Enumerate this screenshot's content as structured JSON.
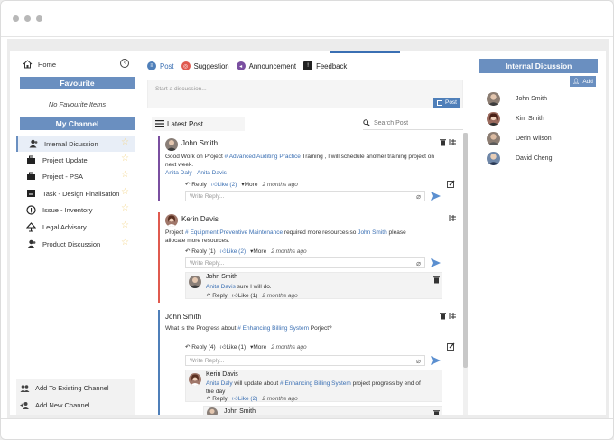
{
  "sidebar": {
    "home_label": "Home",
    "favourite_header": "Favourite",
    "no_favourite": "No Favourite Items",
    "channel_header": "My Channel",
    "channels": [
      {
        "label": "Internal Dicussion",
        "icon": "group-icon",
        "active": true
      },
      {
        "label": "Project Update",
        "icon": "briefcase-icon",
        "active": false
      },
      {
        "label": "Project - PSA",
        "icon": "briefcase-icon",
        "active": false
      },
      {
        "label": "Task - Design Finalisation",
        "icon": "task-list-icon",
        "active": false
      },
      {
        "label": "Issue - Inventory",
        "icon": "alert-circle-icon",
        "active": false
      },
      {
        "label": "Legal Advisory",
        "icon": "scale-icon",
        "active": false
      },
      {
        "label": "Product Discussion",
        "icon": "group-icon",
        "active": false
      }
    ],
    "bottom": {
      "add_existing": "Add To Existing Channel",
      "add_new": "Add New Channel"
    }
  },
  "center": {
    "tabs": [
      {
        "label": "Post",
        "icon": "post-icon",
        "color": "#4f7fb9"
      },
      {
        "label": "Suggestion",
        "icon": "lifebuoy-icon",
        "color": "#e05a4f"
      },
      {
        "label": "Announcement",
        "icon": "megaphone-icon",
        "color": "#7a4fa0"
      },
      {
        "label": "Feedback",
        "icon": "feedback-icon",
        "color": "#222222"
      }
    ],
    "composer_placeholder": "Start a discussion...",
    "post_button": "Post",
    "latest_label": "Latest Post",
    "search_placeholder": "Search Post",
    "reply_placeholder": "Write Reply...",
    "posts": [
      {
        "author": "John Smith",
        "text_before": "Good Work on Project ",
        "tag": "# Advanced Auditing Practice",
        "text_after": " Training , I will schedule another training project on next week.",
        "mentions": [
          "Anita Daly",
          "Anita Davis"
        ],
        "reply": "Reply",
        "like": "Like (2)",
        "more": "More",
        "time": "2 months ago",
        "border_color": "#7a4fa0"
      },
      {
        "author": "Kerin Davis",
        "text_before": "Project ",
        "tag": "# Equipment Preventive Maintenance",
        "text_mid": " required more resources so ",
        "mention": "John Smith",
        "text_after": " please allocate more resources.",
        "reply": "Reply (1)",
        "like": "Like (2)",
        "more": "More",
        "time": "2 months ago",
        "border_color": "#e05a4f",
        "nested": {
          "author": "John Smith",
          "mention": "Anita Davis",
          "text": " sure I will do.",
          "reply": "Reply",
          "like": "Like (1)",
          "time": "2 months ago"
        }
      },
      {
        "author": "John Smith",
        "text_before": "What is the Progress about ",
        "tag": "# Enhancing Billing System",
        "text_after": "  Porject?",
        "reply": "Reply (4)",
        "like": "Like (1)",
        "more": "More",
        "time": "2 months ago",
        "border_color": "#4f7fb9",
        "nested": {
          "author": "Kerin Davis",
          "mention": "Anita Daly",
          "text_mid": " will update about ",
          "tag": "# Enhancing Billing System",
          "text_after": " project progress by end of the day",
          "reply": "Reply",
          "like": "Like (2)",
          "time": "2 months ago"
        },
        "nested2_author": "John Smith"
      }
    ]
  },
  "right": {
    "header": "Internal Dicussion",
    "add_button": "Add",
    "members": [
      "John Smith",
      "Kim Smith",
      "Derin Wilson",
      "David Cheng"
    ]
  }
}
